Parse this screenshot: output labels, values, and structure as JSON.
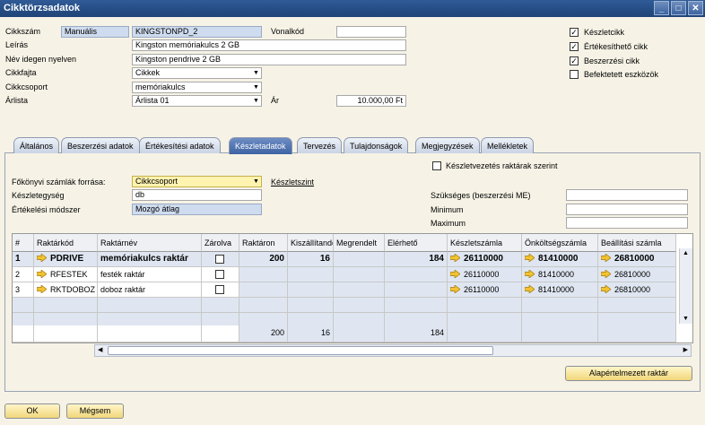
{
  "window": {
    "title": "Cikktörzsadatok"
  },
  "header": {
    "item_number_label": "Cikkszám",
    "series": "Manuális",
    "item_code": "KINGSTONPD_2",
    "barcode_label": "Vonalkód",
    "barcode_value": "",
    "description_label": "Leírás",
    "description": "Kingston memóriakulcs 2 GB",
    "foreign_name_label": "Név idegen nyelven",
    "foreign_name": "Kingston pendrive 2 GB",
    "item_type_label": "Cikkfajta",
    "item_type": "Cikkek",
    "item_group_label": "Cikkcsoport",
    "item_group": "memóriakulcs",
    "price_list_label": "Árlista",
    "price_list": "Árlista 01",
    "price_label": "Ár",
    "price": "10.000,00 Ft",
    "inventory_item_label": "Készletcikk",
    "sales_item_label": "Értékesíthető cikk",
    "purchase_item_label": "Beszerzési cikk",
    "fixed_asset_label": "Befektetett eszközök"
  },
  "tabs": [
    "Általános",
    "Beszerzési adatok",
    "Értékesítési adatok",
    "Készletadatok",
    "Tervezés",
    "Tulajdonságok",
    "Megjegyzések",
    "Mellékletek"
  ],
  "inventory": {
    "gl_source_label": "Főkönyvi számlák forrása:",
    "gl_source": "Cikkcsoport",
    "level_link": "Készletszint",
    "unit_label": "Készletegység",
    "unit": "db",
    "valuation_label": "Értékelési módszer",
    "valuation": "Mozgó átlag",
    "by_warehouse_label": "Készletvezetés raktárak szerint",
    "required_label": "Szükséges (beszerzési ME)",
    "minimum_label": "Minimum",
    "maximum_label": "Maximum"
  },
  "grid": {
    "columns": [
      "#",
      "Raktárkód",
      "Raktárnév",
      "Zárolva",
      "Raktáron",
      "Kiszállítandó",
      "Megrendelt",
      "Elérhető",
      "Készletszámla",
      "Önköltségszámla",
      "Beállítási számla"
    ],
    "rows": [
      {
        "n": "1",
        "code": "PDRIVE",
        "name": "memóriakulcs raktár",
        "stock": "200",
        "ship": "16",
        "ordered": "",
        "avail": "184",
        "acc1": "26110000",
        "acc2": "81410000",
        "acc3": "26810000"
      },
      {
        "n": "2",
        "code": "RFESTEK",
        "name": "festék raktár",
        "stock": "",
        "ship": "",
        "ordered": "",
        "avail": "",
        "acc1": "26110000",
        "acc2": "81410000",
        "acc3": "26810000"
      },
      {
        "n": "3",
        "code": "RKTDOBOZ",
        "name": "doboz raktár",
        "stock": "",
        "ship": "",
        "ordered": "",
        "avail": "",
        "acc1": "26110000",
        "acc2": "81410000",
        "acc3": "26810000"
      }
    ],
    "totals": {
      "stock": "200",
      "ship": "16",
      "avail": "184"
    }
  },
  "buttons": {
    "default_warehouse": "Alapértelmezett raktár",
    "ok": "OK",
    "cancel": "Mégsem"
  },
  "colors": {
    "titlebar": "#1f4477",
    "active_tab": "#3f63a3",
    "button": "#f1d77a",
    "arrow": "#f2c230"
  }
}
